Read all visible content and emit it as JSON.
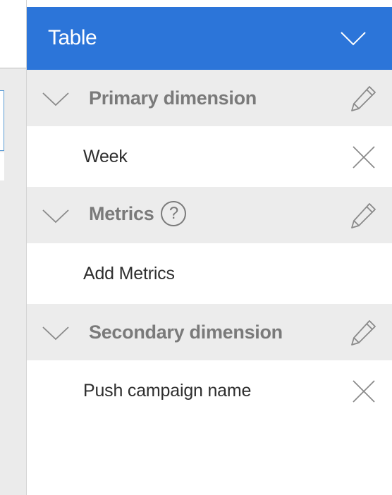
{
  "panel": {
    "title": "Table",
    "header_icon": "chevron-down-icon",
    "header_color": "#2c75d9"
  },
  "sections": [
    {
      "title": "Primary dimension",
      "collapse_icon": "chevron-down-icon",
      "edit_icon": "pencil-icon",
      "item": {
        "label": "Week",
        "action_icon": "close-icon"
      }
    },
    {
      "title": "Metrics",
      "help_icon": "question-mark-icon",
      "help_label": "?",
      "collapse_icon": "chevron-down-icon",
      "edit_icon": "pencil-icon",
      "item": {
        "label": "Add Metrics"
      }
    },
    {
      "title": "Secondary dimension",
      "collapse_icon": "chevron-down-icon",
      "edit_icon": "pencil-icon",
      "item": {
        "label": "Push campaign name",
        "action_icon": "close-icon"
      }
    }
  ],
  "colors": {
    "section_bg": "#ececec",
    "section_text": "#7a7a7a",
    "item_text": "#2e2e2e"
  }
}
